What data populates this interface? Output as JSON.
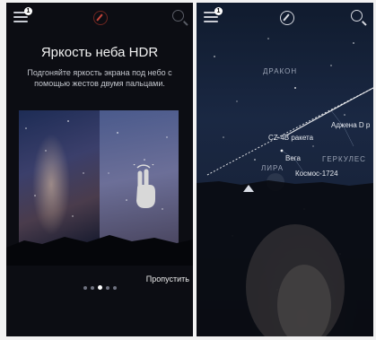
{
  "left_panel": {
    "title": "Яркость неба HDR",
    "subtitle": "Подгоняйте яркость экрана под небо с помощью жестов двумя пальцами.",
    "skip_label": "Пропустить",
    "pager": {
      "count": 5,
      "active_index": 2
    },
    "badge_count": "1",
    "icons": [
      "menu-icon",
      "compass-icon",
      "search-icon",
      "two-finger-hand-icon"
    ]
  },
  "right_panel": {
    "badge_count": "1",
    "icons": [
      "menu-icon",
      "compass-icon",
      "search-icon",
      "horizon-marker-icon"
    ],
    "labels": {
      "dragon": "ДРАКОН",
      "rocket": "CZ-4B ракета",
      "adzhena": "Аджена D р",
      "vega": "Вега",
      "hercules": "ГЕРКУЛЕС",
      "lyra": "ЛИРА",
      "cosmos": "Космос-1724"
    }
  },
  "colors": {
    "accent": "#e0533a",
    "text": "#f2f2f2",
    "muted": "#c3c6cd"
  }
}
